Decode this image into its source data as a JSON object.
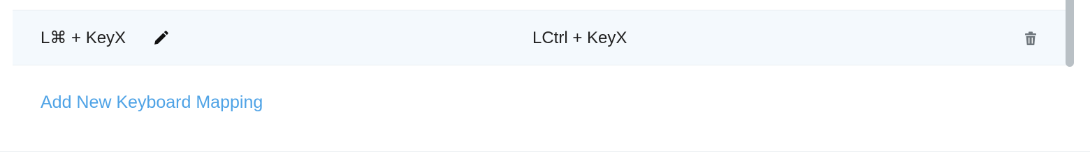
{
  "mapping": {
    "from": "L⌘ + KeyX",
    "to": "LCtrl + KeyX",
    "edit_icon": "pencil-icon",
    "delete_icon": "trash-icon"
  },
  "add_mapping_label": "Add New Keyboard Mapping",
  "colors": {
    "row_background": "#f4f9fd",
    "link": "#4fa3e6",
    "text": "#222222",
    "icon": "#6f777d"
  }
}
